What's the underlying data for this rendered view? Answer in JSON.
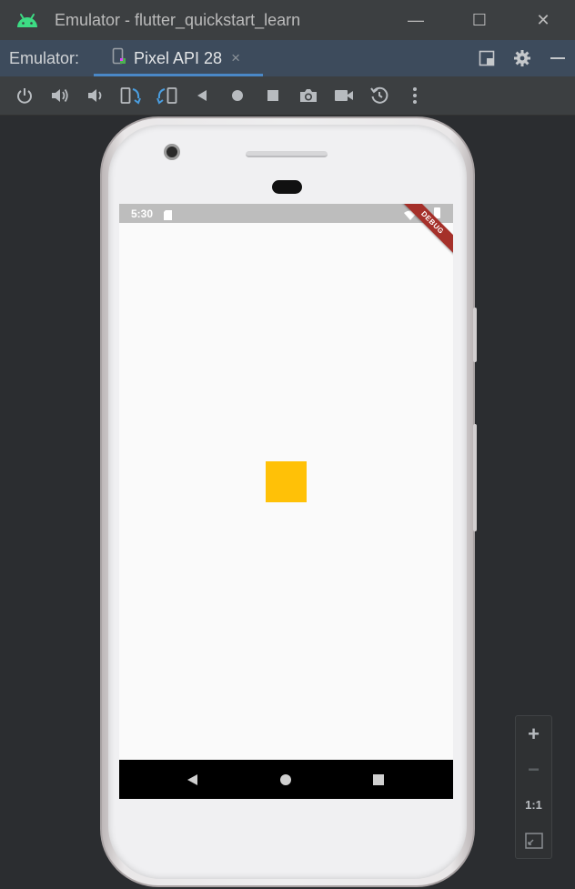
{
  "window": {
    "title": "Emulator - flutter_quickstart_learn",
    "minimize_glyph": "—",
    "maximize_glyph": "☐",
    "close_glyph": "✕"
  },
  "tool_window": {
    "label": "Emulator:",
    "tab": {
      "label": "Pixel API 28",
      "close_glyph": "×",
      "icon": "device-icon"
    },
    "icons": [
      "layout-icon",
      "gear-icon",
      "hide-icon"
    ]
  },
  "toolbar": {
    "icons": [
      "power-icon",
      "volume-up-icon",
      "volume-down-icon",
      "rotate-left-icon",
      "rotate-right-icon",
      "back-icon",
      "home-icon",
      "overview-icon",
      "camera-icon",
      "record-icon",
      "snapshot-icon",
      "more-icon"
    ]
  },
  "device": {
    "status_bar": {
      "time": "5:30"
    },
    "debug_ribbon": "DEBUG",
    "box_color": "#ffc107",
    "nav": [
      "nav-back-icon",
      "nav-home-icon",
      "nav-recents-icon"
    ]
  },
  "zoom_panel": {
    "zoom_in": "+",
    "zoom_out": "−",
    "ratio": "1:1"
  },
  "colors": {
    "accent": "#4a88c7",
    "android_green": "#3ddc84",
    "ribbon": "#a5302a"
  }
}
